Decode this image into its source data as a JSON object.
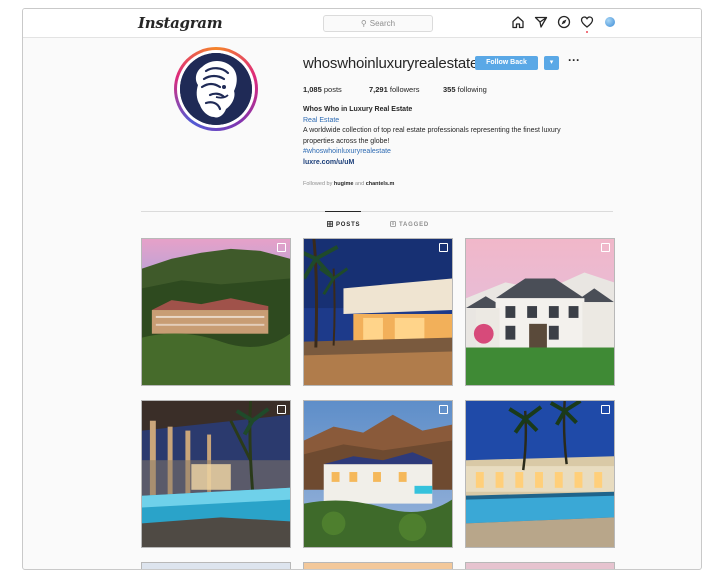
{
  "header": {
    "logo": "Instagram",
    "search_placeholder": "Search",
    "icons": [
      "home-icon",
      "direct-icon",
      "explore-icon",
      "activity-icon",
      "profile-avatar"
    ]
  },
  "profile": {
    "username": "whoswhoinluxuryrealestate",
    "follow_back_label": "Follow Back",
    "posts_count": "1,085",
    "posts_label": "posts",
    "followers_count": "7,291",
    "followers_label": "followers",
    "following_count": "355",
    "following_label": "following",
    "bio": {
      "name": "Whos Who in Luxury Real Estate",
      "category": "Real Estate",
      "description_line1": "A worldwide collection of top real estate professionals representing the finest luxury",
      "description_line2": "properties across the globe!",
      "hashtag": "#whoswhoinluxuryrealestate",
      "link": "luxre.com/u/uM"
    },
    "followed_by_prefix": "Followed by",
    "followed_by_user1": "hugime",
    "followed_by_and": "and",
    "followed_by_user2": "chantels.m"
  },
  "tabs": [
    {
      "label": "POSTS",
      "active": true,
      "icon": "grid-icon"
    },
    {
      "label": "TAGGED",
      "active": false,
      "icon": "tag-icon"
    }
  ],
  "colors": {
    "accent": "#5aa8e6",
    "link": "#2e6bb3",
    "notification": "#ed4956"
  }
}
